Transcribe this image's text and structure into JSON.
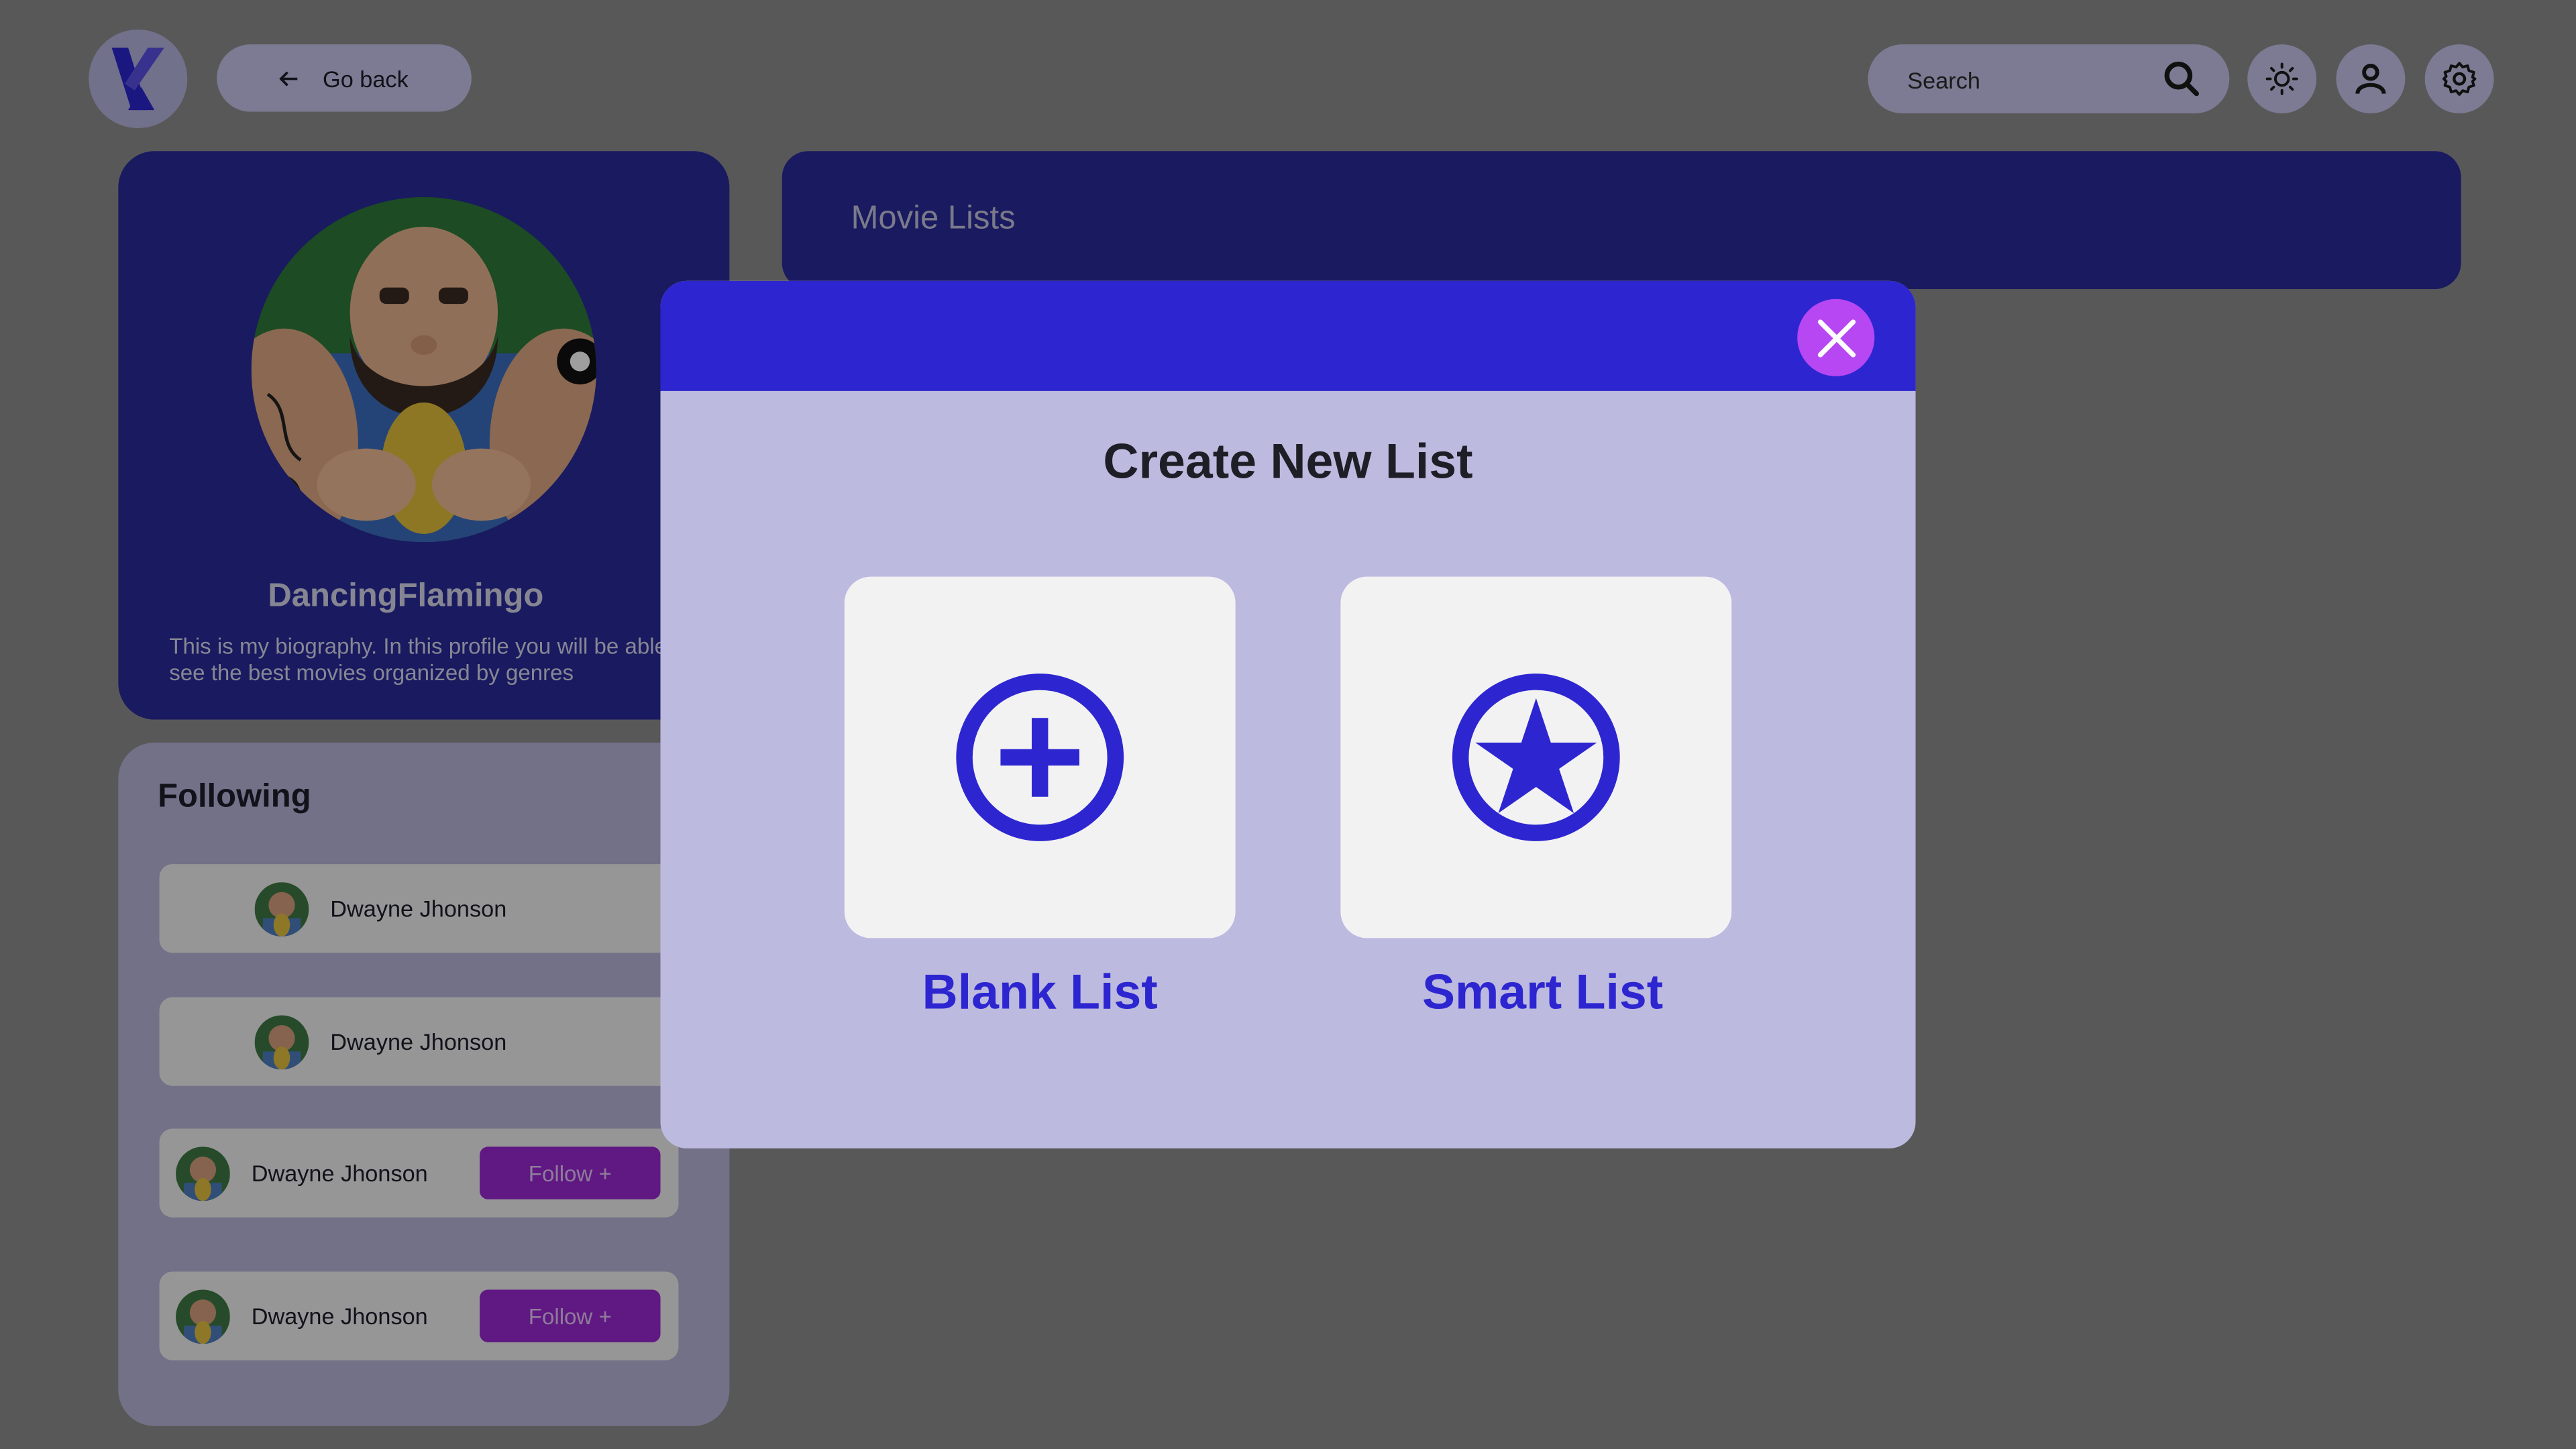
{
  "header": {
    "logo_text": "X",
    "back_label": "Go back",
    "search_placeholder": "Search"
  },
  "profile": {
    "username": "DancingFlamingo",
    "bio": "This is my biography. In this profile you will be able to see the best movies organized by genres"
  },
  "following": {
    "title": "Following",
    "items": [
      {
        "name": "Dwayne Jhonson",
        "button": ""
      },
      {
        "name": "Dwayne Jhonson",
        "button": ""
      },
      {
        "name": "Dwayne Jhonson",
        "button": "Follow +"
      },
      {
        "name": "Dwayne Jhonson",
        "button": "Follow +"
      }
    ]
  },
  "movie_lists": {
    "title": "Movie Lists"
  },
  "modal": {
    "title": "Create New List",
    "options": [
      {
        "label": "Blank List",
        "icon": "plus-circle-icon"
      },
      {
        "label": "Smart List",
        "icon": "star-circle-icon"
      }
    ]
  },
  "colors": {
    "primary": "#2d26d0",
    "close_button": "#b647f2",
    "follow_button": "#9b27d4",
    "modal_bg": "#bcbadf"
  }
}
